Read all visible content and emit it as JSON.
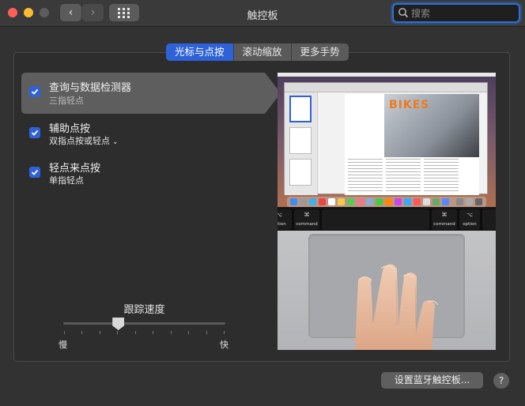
{
  "window": {
    "title": "触控板"
  },
  "search": {
    "placeholder": "搜索"
  },
  "tabs": [
    {
      "label": "光标与点按",
      "active": true
    },
    {
      "label": "滚动缩放",
      "active": false
    },
    {
      "label": "更多手势",
      "active": false
    }
  ],
  "options": [
    {
      "title": "查询与数据检测器",
      "subtitle": "三指轻点",
      "checked": true,
      "selected": true
    },
    {
      "title": "辅助点按",
      "subtitle": "双指点按或轻点",
      "checked": true,
      "selected": false,
      "has_dropdown": true
    },
    {
      "title": "轻点来点按",
      "subtitle": "单指轻点",
      "checked": true,
      "selected": false
    }
  ],
  "tracking_speed": {
    "label": "跟踪速度",
    "min_label": "慢",
    "max_label": "快",
    "value_fraction": 0.34
  },
  "preview": {
    "doc_title": "BIKES",
    "touchbar_keys": [
      {
        "symbol": "⌥",
        "label": "option"
      },
      {
        "symbol": "⌘",
        "label": "command"
      },
      {
        "symbol": "⌘",
        "label": "command"
      },
      {
        "symbol": "⌥",
        "label": "option"
      }
    ]
  },
  "footer": {
    "bluetooth_button": "设置蓝牙触控板...",
    "help": "?"
  },
  "colors": {
    "accent": "#2e62d9",
    "background": "#323232",
    "close": "#fe5f57",
    "minimize": "#febc2e"
  }
}
